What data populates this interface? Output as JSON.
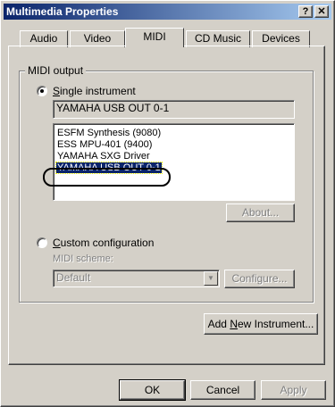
{
  "window": {
    "title": "Multimedia Properties",
    "help_btn": "?",
    "close_btn": "✕"
  },
  "tabs": [
    {
      "label": "Audio",
      "active": false
    },
    {
      "label": "Video",
      "active": false
    },
    {
      "label": "MIDI",
      "active": true
    },
    {
      "label": "CD Music",
      "active": false
    },
    {
      "label": "Devices",
      "active": false
    }
  ],
  "midi_output": {
    "group_label": "MIDI output",
    "single_instrument": {
      "accel": "S",
      "rest": "ingle instrument",
      "selected": true,
      "current_value": "YAMAHA USB OUT 0-1"
    },
    "instruments": [
      "ESFM Synthesis (9080)",
      "ESS MPU-401 (9400)",
      "YAMAHA SXG Driver",
      "YAMAHA USB OUT 0-1"
    ],
    "selected_instrument": "YAMAHA USB OUT 0-1",
    "about_btn": "About...",
    "custom_configuration": {
      "accel": "C",
      "rest": "ustom configuration",
      "selected": false
    },
    "midi_scheme_label": "MIDI scheme:",
    "midi_scheme_value": "Default",
    "configure_btn": "Configure..."
  },
  "add_instrument_btn": {
    "pre": "Add ",
    "accel": "N",
    "post": "ew Instrument..."
  },
  "footer": {
    "ok": "OK",
    "cancel": "Cancel",
    "apply": "Apply"
  }
}
